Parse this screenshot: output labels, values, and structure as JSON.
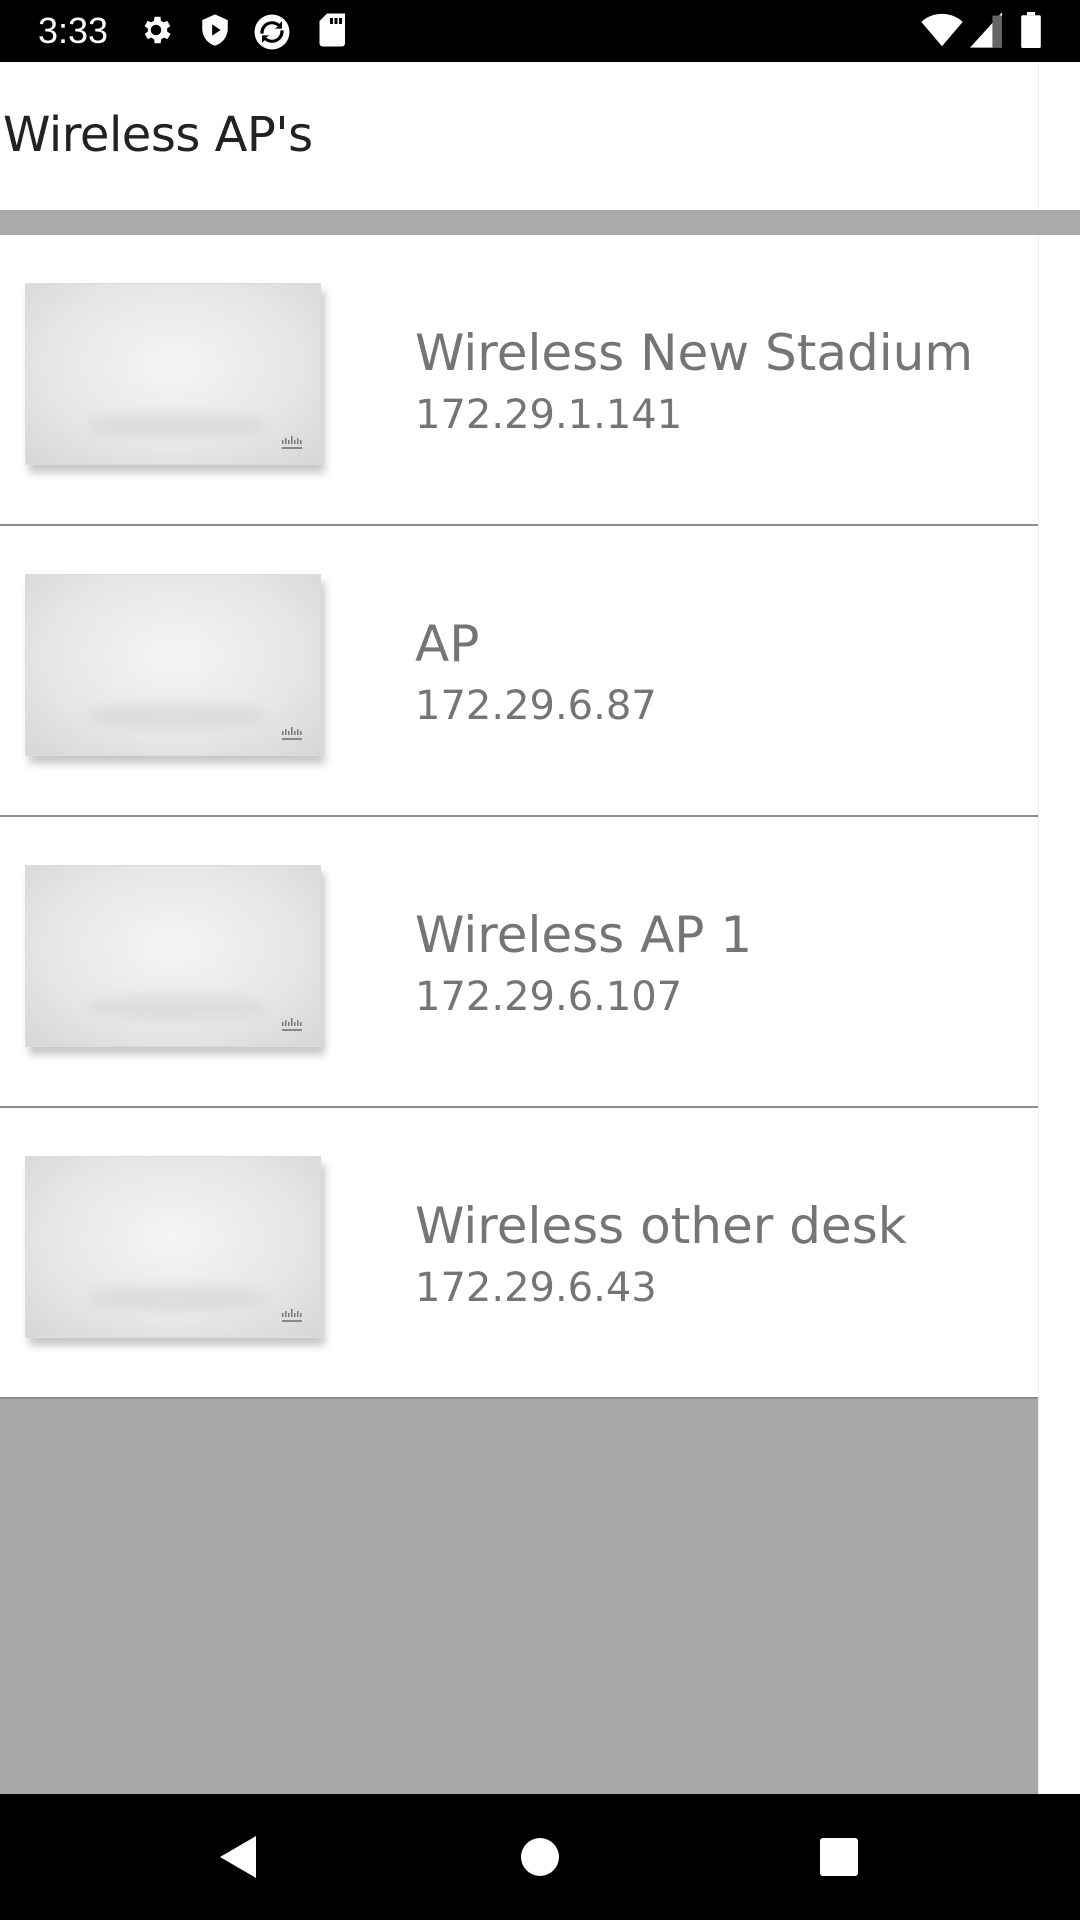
{
  "status_bar": {
    "time": "3:33",
    "left_icons": [
      "gear-icon",
      "shield-icon",
      "sync-icon",
      "sd-card-icon"
    ],
    "right_icons": [
      "wifi-icon",
      "signal-icon",
      "battery-icon"
    ]
  },
  "header": {
    "title": "Wireless AP's"
  },
  "access_points": [
    {
      "name": "Wireless New Stadium",
      "ip": "172.29.1.141",
      "thumbnail": "cisco-access-point-image"
    },
    {
      "name": "AP",
      "ip": "172.29.6.87",
      "thumbnail": "cisco-access-point-image"
    },
    {
      "name": "Wireless AP 1",
      "ip": "172.29.6.107",
      "thumbnail": "cisco-access-point-image"
    },
    {
      "name": "Wireless other desk",
      "ip": "172.29.6.43",
      "thumbnail": "cisco-access-point-image"
    }
  ],
  "nav_bar": {
    "buttons": [
      "back-icon",
      "home-icon",
      "recents-icon"
    ]
  },
  "colors": {
    "status_bar_bg": "#000000",
    "divider_gray": "#aaaaaa",
    "text_secondary": "#757575",
    "title_text": "#222222"
  }
}
